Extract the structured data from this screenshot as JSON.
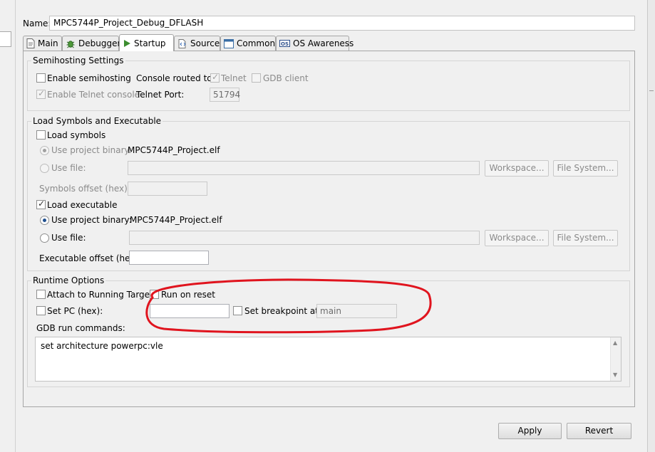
{
  "name_label": "Name:",
  "config_name": "MPC5744P_Project_Debug_DFLASH",
  "tabs": [
    {
      "label": "Main",
      "icon": "document-icon",
      "active": false
    },
    {
      "label": "Debugger",
      "icon": "bug-icon",
      "active": false
    },
    {
      "label": "Startup",
      "icon": "play-icon",
      "active": true
    },
    {
      "label": "Source",
      "icon": "source-icon",
      "active": false
    },
    {
      "label": "Common",
      "icon": "window-icon",
      "active": false
    },
    {
      "label": "OS Awareness",
      "icon": "os-icon",
      "active": false
    }
  ],
  "semihosting": {
    "title": "Semihosting Settings",
    "enable_semihosting": "Enable semihosting",
    "console_routed_to": "Console routed to:",
    "telnet": "Telnet",
    "gdb_client": "GDB client",
    "enable_telnet_console": "Enable Telnet console",
    "telnet_port_label": "Telnet Port:",
    "telnet_port_value": "51794"
  },
  "load": {
    "title": "Load Symbols and Executable",
    "load_symbols": "Load symbols",
    "use_project_binary": "Use project binary:",
    "symbols_binary": "MPC5744P_Project.elf",
    "use_file": "Use file:",
    "workspace": "Workspace...",
    "file_system": "File System...",
    "symbols_offset": "Symbols offset (hex):",
    "load_executable": "Load executable",
    "exec_binary": "MPC5744P_Project.elf",
    "executable_offset": "Executable offset (hex):"
  },
  "runtime": {
    "title": "Runtime Options",
    "attach_running": "Attach to Running Target",
    "run_on_reset": "Run on reset",
    "set_pc": "Set PC (hex):",
    "set_breakpoint": "Set breakpoint at:",
    "breakpoint_value": "main",
    "gdb_run_commands": "GDB run commands:",
    "gdb_commands_text": "set architecture powerpc:vle"
  },
  "buttons": {
    "apply": "Apply",
    "revert": "Revert"
  },
  "colors": {
    "highlight": "#e0141e",
    "accent_check": "#1f4f8f"
  }
}
